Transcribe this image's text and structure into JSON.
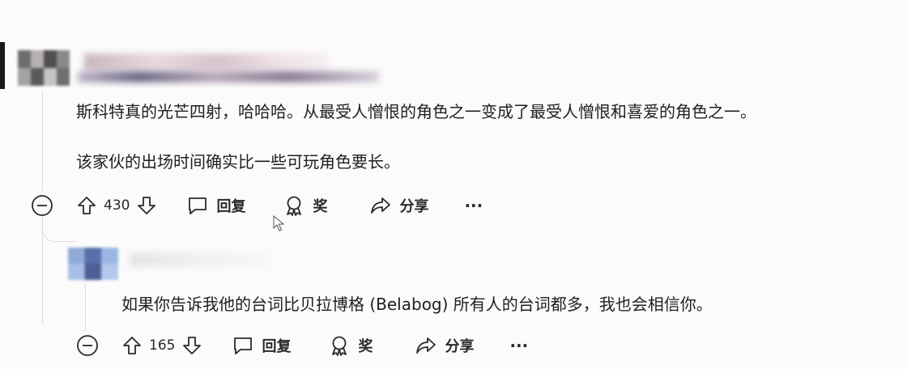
{
  "comments": [
    {
      "body": [
        "斯科特真的光芒四射，哈哈哈。从最受人憎恨的角色之一变成了最受人憎恨和喜爱的角色之一。",
        "该家伙的出场时间确实比一些可玩角色要长。"
      ],
      "votes": "430",
      "actions": {
        "reply": "回复",
        "award": "奖",
        "share": "分享",
        "more": "···"
      }
    },
    {
      "body": [
        "如果你告诉我他的台词比贝拉博格 (Belabog) 所有人的台词都多，我也会相信你。"
      ],
      "votes": "165",
      "actions": {
        "reply": "回复",
        "award": "奖",
        "share": "分享",
        "more": "···"
      }
    }
  ],
  "icons": [
    "collapse-icon",
    "upvote-icon",
    "downvote-icon",
    "reply-icon",
    "award-icon",
    "share-icon",
    "more-icon",
    "cursor-icon"
  ]
}
